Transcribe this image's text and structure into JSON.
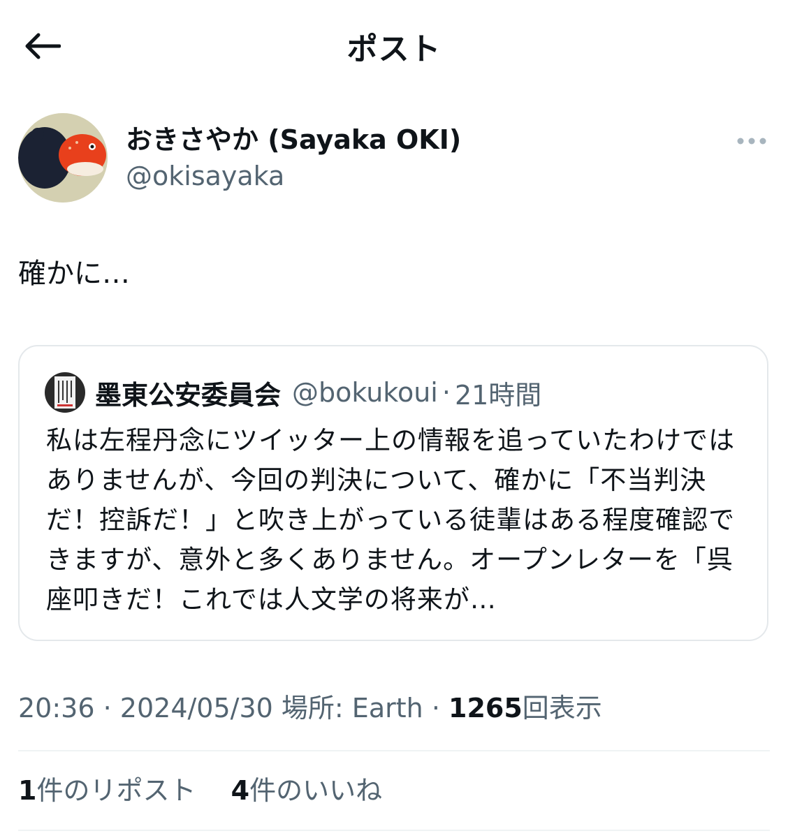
{
  "header": {
    "title": "ポスト"
  },
  "author": {
    "display_name": "おきさやか (Sayaka OKI)",
    "handle": "@okisayaka"
  },
  "tweet": {
    "text": "確かに…"
  },
  "quoted": {
    "display_name": "墨東公安委員会",
    "handle": "@bokukoui",
    "separator": "·",
    "time": "21時間",
    "body": "私は左程丹念にツイッター上の情報を追っていたわけではありませんが、今回の判決について、確かに「不当判決だ！控訴だ！」と吹き上がっている徒輩はある程度確認できますが、意外と多くありません。オープンレターを「呉座叩きだ！これでは人文学の将来が…"
  },
  "meta": {
    "time": "20:36",
    "sep1": "·",
    "date": "2024/05/30",
    "location": "場所: Earth",
    "sep2": "·",
    "views_count": "1265",
    "views_label": "回表示"
  },
  "stats": {
    "reposts_count": "1",
    "reposts_label": "件のリポスト",
    "likes_count": "4",
    "likes_label": "件のいいね"
  },
  "icons": {
    "back": "arrow-left-icon",
    "more": "more-horizontal-icon"
  },
  "colors": {
    "text": "#0f1419",
    "secondary": "#536471",
    "border": "#e4e8eb"
  }
}
